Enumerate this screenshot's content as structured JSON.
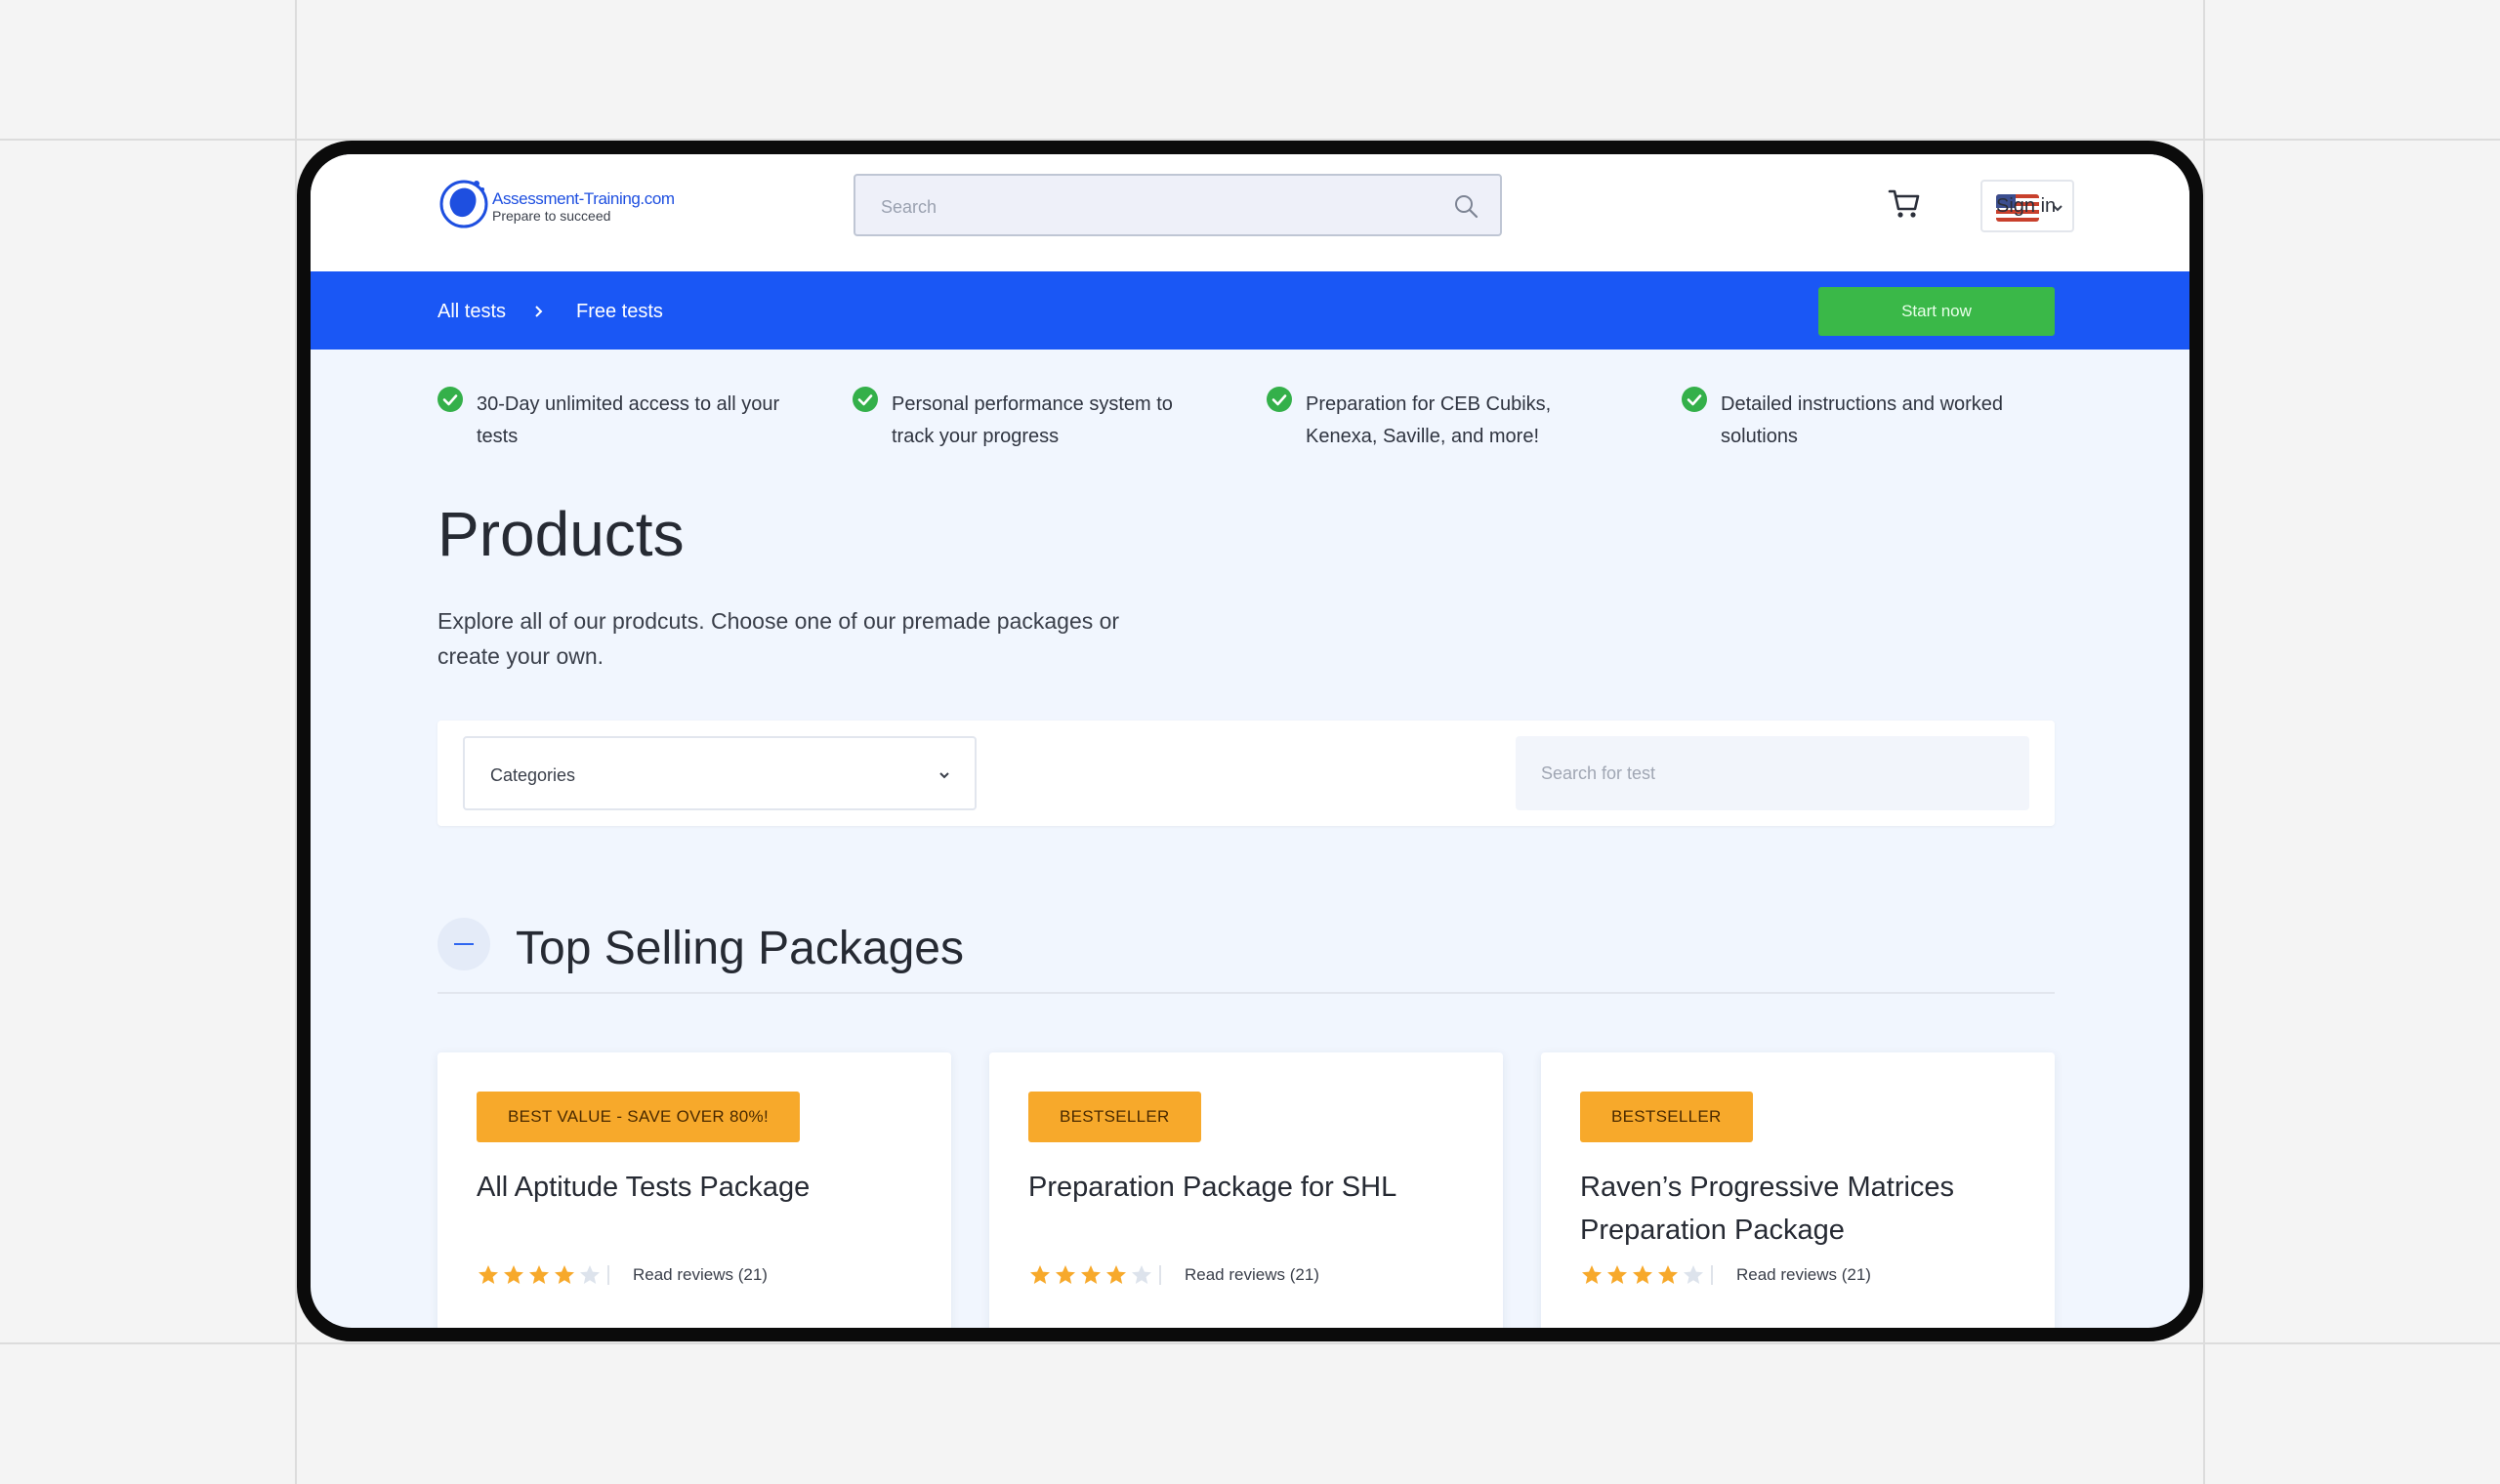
{
  "header": {
    "logo_title": "Assessment-Training.com",
    "logo_subtitle": "Prepare to succeed",
    "search_placeholder": "Search",
    "sign_in": "Sign in"
  },
  "nav": {
    "all_tests": "All tests",
    "free_tests": "Free tests",
    "start_now": "Start now"
  },
  "features": [
    {
      "text": "30-Day unlimited access to all your tests"
    },
    {
      "text": "Personal performance system to track your progress"
    },
    {
      "text": "Preparation for CEB Cubiks, Kenexa, Saville, and more!"
    },
    {
      "text": "Detailed instructions and worked solutions"
    }
  ],
  "products": {
    "title": "Products",
    "description": "Explore all of our prodcuts. Choose one of our premade packages or create your own."
  },
  "filters": {
    "categories_label": "Categories",
    "search_placeholder": "Search for test"
  },
  "section": {
    "title": "Top Selling Packages"
  },
  "cards": [
    {
      "badge": "BEST VALUE - SAVE OVER 80%!",
      "title": "All Aptitude Tests Package",
      "rating": 4,
      "reviews": "Read reviews (21)"
    },
    {
      "badge": "BESTSELLER",
      "title": "Preparation Package for SHL",
      "rating": 4,
      "reviews": "Read reviews (21)"
    },
    {
      "badge": "BESTSELLER",
      "title": "Raven’s Progressive Matrices Preparation Package",
      "rating": 4,
      "reviews": "Read reviews (21)"
    }
  ],
  "colors": {
    "accent_blue": "#1a57f5",
    "cta_green": "#3ab848",
    "badge_orange": "#f7a92b",
    "check_green": "#34b04a",
    "star_filled": "#f7a92b",
    "star_empty": "#dde3ec"
  }
}
